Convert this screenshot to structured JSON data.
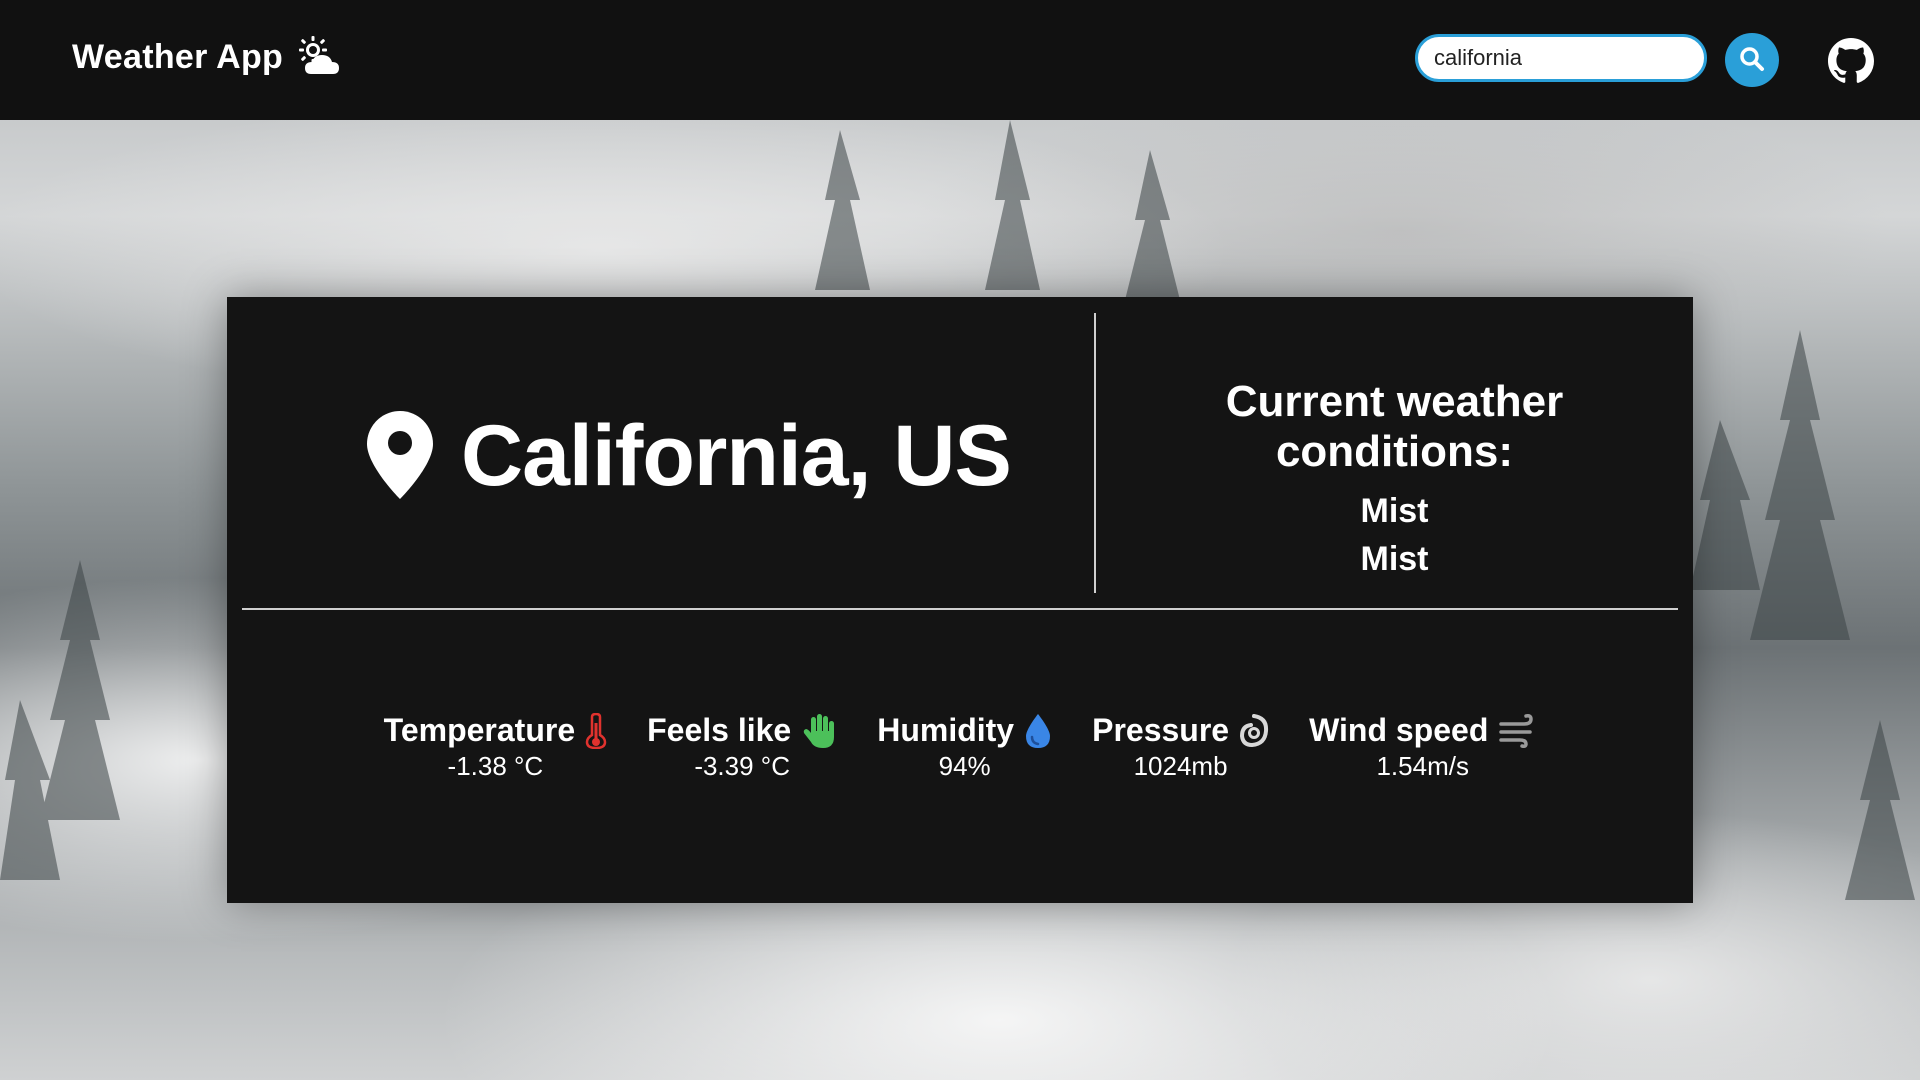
{
  "app": {
    "title": "Weather App",
    "brand_icon": "sun-cloud-icon"
  },
  "search": {
    "value": "california",
    "placeholder": "",
    "button_icon": "search-icon",
    "accent_color": "#2a9fd8"
  },
  "github": {
    "icon": "github-icon"
  },
  "location": {
    "icon": "location-pin-icon",
    "name": "California, US"
  },
  "conditions": {
    "title": "Current weather conditions:",
    "lines": [
      "Mist",
      "Mist"
    ]
  },
  "stats": [
    {
      "label": "Temperature",
      "value": "-1.38 °C",
      "icon": "thermometer-icon",
      "color": "#e0322e"
    },
    {
      "label": "Feels like",
      "value": "-3.39 °C",
      "icon": "hand-icon",
      "color": "#4cc05a"
    },
    {
      "label": "Humidity",
      "value": "94%",
      "icon": "water-drop-icon",
      "color": "#3a86e6"
    },
    {
      "label": "Pressure",
      "value": "1024mb",
      "icon": "pressure-icon",
      "color": "#d8d8d8"
    },
    {
      "label": "Wind speed",
      "value": "1.54m/s",
      "icon": "wind-icon",
      "color": "#9a9a9a"
    }
  ]
}
